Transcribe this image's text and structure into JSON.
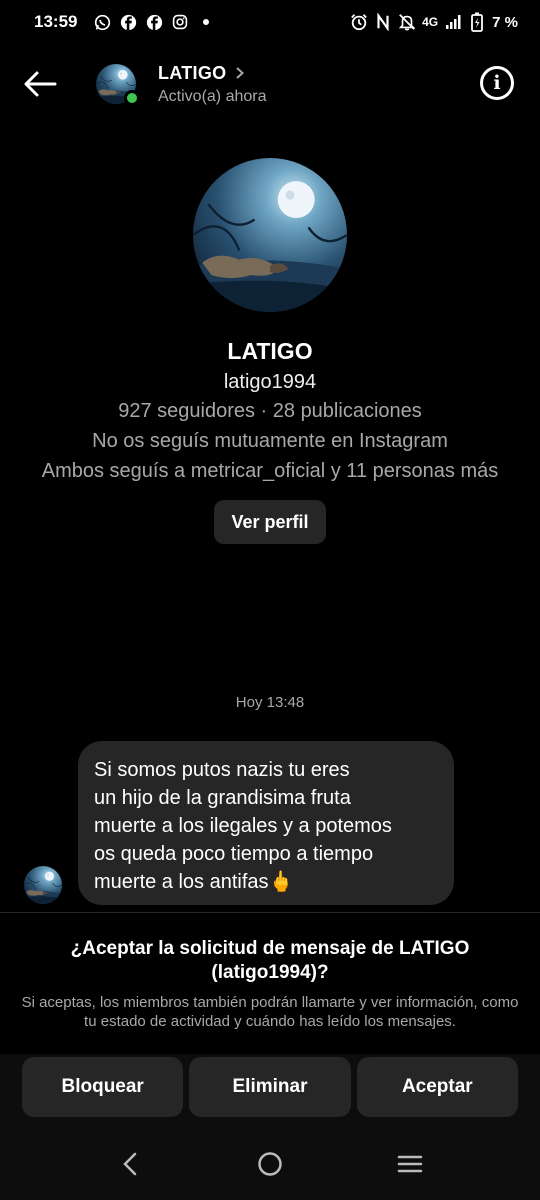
{
  "status_bar": {
    "time": "13:59",
    "left_icons": [
      "whatsapp-icon",
      "facebook-icon",
      "facebook-icon",
      "instagram-icon",
      "dot-icon"
    ],
    "right_icons": [
      "alarm-icon",
      "nfc-icon",
      "mute-icon",
      "signal-icon",
      "battery-icon"
    ],
    "network": "4G",
    "battery": "7 %"
  },
  "header": {
    "name": "LATIGO",
    "status": "Activo(a) ahora"
  },
  "profile": {
    "name": "LATIGO",
    "username": "latigo1994",
    "stats": "927 seguidores · 28 publicaciones",
    "mutual_follow": "No os seguís mutuamente en Instagram",
    "followed_by": "Ambos seguís a metricar_oficial y 11 personas más",
    "view_profile_label": "Ver perfil"
  },
  "chat": {
    "timestamp": "Hoy 13:48",
    "message": "Si somos putos nazis tu eres\nun hijo de la grandisima fruta\nmuerte a los ilegales y a potemos\nos queda poco tiempo a tiempo\nmuerte a los antifas🖕"
  },
  "request": {
    "title": "¿Aceptar la solicitud de mensaje de LATIGO (latigo1994)?",
    "description": "Si aceptas, los miembros también podrán llamarte y ver información, como tu estado de actividad y cuándo has leído los mensajes."
  },
  "actions": {
    "block": "Bloquear",
    "delete": "Eliminar",
    "accept": "Aceptar"
  },
  "colors": {
    "background": "#000000",
    "bubble": "#262626",
    "secondary_text": "#a8a8a8",
    "online": "#3ec650"
  }
}
